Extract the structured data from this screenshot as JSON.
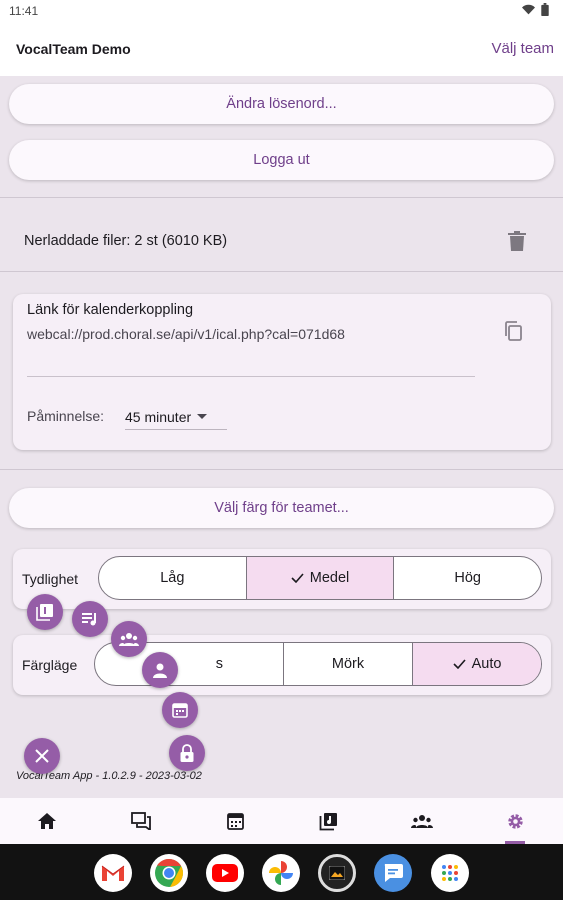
{
  "status": {
    "time": "11:41"
  },
  "header": {
    "title": "VocalTeam Demo",
    "team_link": "Välj team"
  },
  "account": {
    "change_password": "Ändra lösenord...",
    "logout": "Logga ut"
  },
  "files": {
    "downloaded": "Nerladdade filer: 2 st (6010 KB)"
  },
  "calendar": {
    "title": "Länk för kalenderkoppling",
    "url": "webcal://prod.choral.se/api/v1/ical.php?cal=071d68",
    "reminder_label": "Påminnelse:",
    "reminder_value": "45 minuter"
  },
  "team_color": {
    "button": "Välj färg för teamet..."
  },
  "clarity": {
    "label": "Tydlighet",
    "options": [
      "Låg",
      "Medel",
      "Hög"
    ],
    "selected": "Medel"
  },
  "color_mode": {
    "label": "Färgläge",
    "options": [
      "Ljus",
      "Mörk",
      "Auto"
    ],
    "partial_first": "s",
    "selected": "Auto"
  },
  "version": "VocalTeam App - 1.0.2.9 - 2023-03-02",
  "colors": {
    "accent": "#955da7",
    "accent_text": "#6f3f8a",
    "selected_segment": "#f5dcf0",
    "background": "#ebe4ec"
  },
  "speed_dial": [
    "library-icon",
    "playlist-icon",
    "groups-icon",
    "person-icon",
    "calendar-icon",
    "lock-icon",
    "close-icon"
  ],
  "bottom_nav": [
    "home-icon",
    "chat-icon",
    "calendar-icon",
    "library-icon",
    "groups-icon",
    "settings-icon"
  ],
  "dock": [
    "gmail-icon",
    "chrome-icon",
    "youtube-icon",
    "photos-icon",
    "gallery-icon",
    "messages-icon",
    "apps-icon"
  ]
}
